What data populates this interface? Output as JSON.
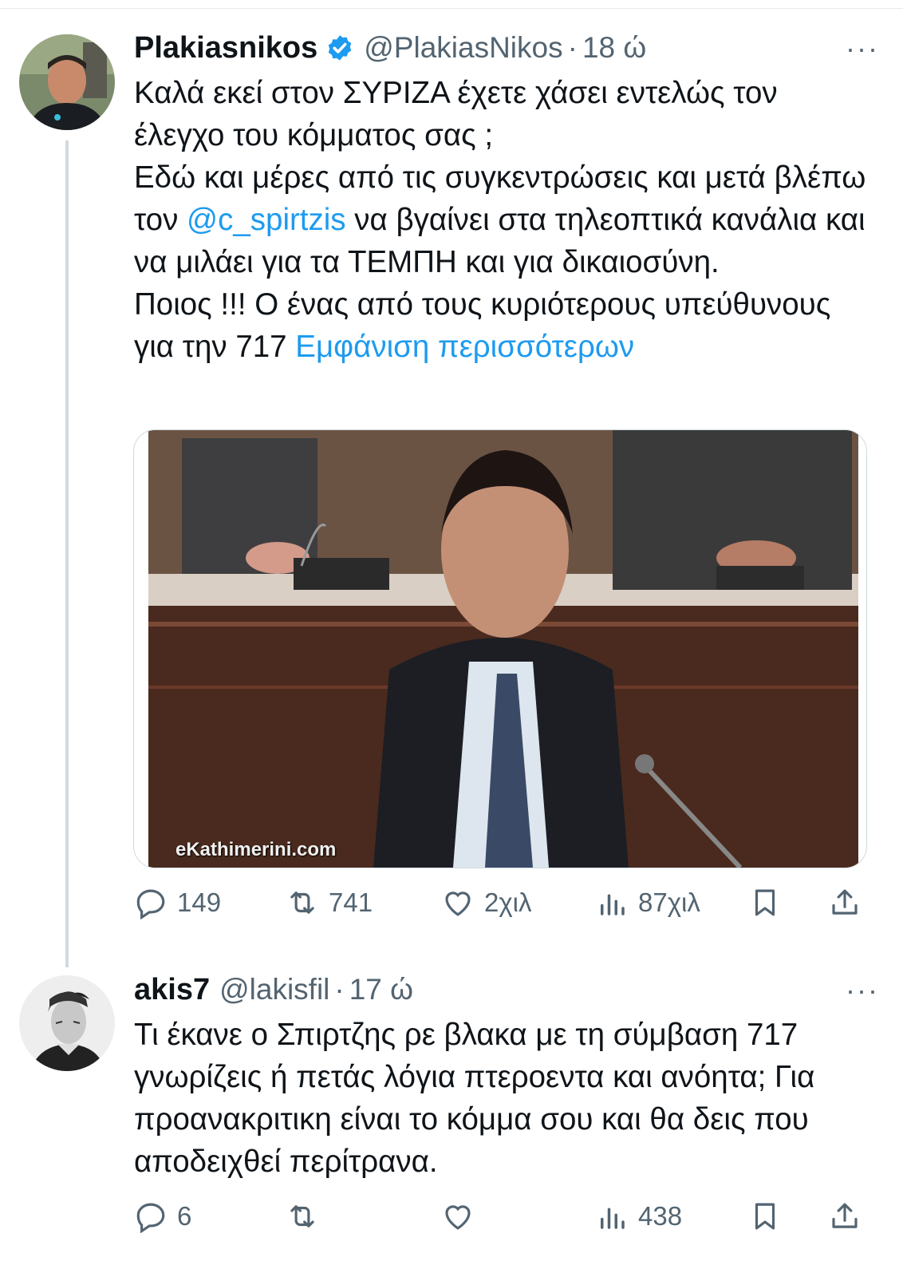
{
  "colors": {
    "accent": "#1d9bf0",
    "secondary_text": "#536471",
    "divider": "#cfd9de"
  },
  "tweets": [
    {
      "name": "Plakiasnikos",
      "verified": true,
      "handle": "@PlakiasNikos",
      "separator": "·",
      "time": "18 ώ",
      "more": "···",
      "lines": {
        "p1": "Καλά εκεί στον ΣΥΡΙΖΑ έχετε χάσει εντελώς τον έλεγχο του κόμματος σας ;",
        "p2_start": "Εδώ και μέρες από τις συγκεντρώσεις και μετά βλέπω τον ",
        "mention": "@c_spirtzis",
        "p2_end": " να βγαίνει στα τηλεοπτικά κανάλια και να μιλάει για τα ΤΕΜΠΗ και για δικαιοσύνη.",
        "p3": "Ποιος !!! Ο ένας από τους κυριότερους υπεύθυνους για την 717 ",
        "show_more": "Εμφάνιση περισσότερων"
      },
      "media_watermark": "eKathimerini.com",
      "stats": {
        "replies": "149",
        "retweets": "741",
        "likes": "2χιλ",
        "views": "87χιλ"
      }
    },
    {
      "name": "akis7",
      "handle": "@lakisfil",
      "separator": "·",
      "time": "17 ώ",
      "more": "···",
      "text": "Τι έκανε ο Σπιρτζης ρε βλακα με τη σύμβαση 717 γνωρίζεις ή πετάς λόγια πτεροεντα και ανόητα; Για προανακριτικη είναι το κόμμα σου και θα δεις που αποδειχθεί περίτρανα.",
      "stats": {
        "replies": "6",
        "retweets": "",
        "likes": "",
        "views": "438"
      }
    }
  ],
  "icons": [
    "reply-icon",
    "retweet-icon",
    "like-icon",
    "views-icon",
    "bookmark-icon",
    "share-icon",
    "verified-badge-icon",
    "more-icon"
  ]
}
